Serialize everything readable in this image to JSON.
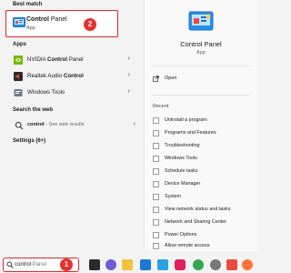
{
  "left": {
    "best_match_title": "Best match",
    "best_match": {
      "name_bold": "Control",
      "name_rest": " Panel",
      "sub": "App"
    },
    "apps_title": "Apps",
    "apps": [
      {
        "pre": "NVIDIA ",
        "bold": "Control",
        "post": " Panel",
        "icon": "nvidia-icon"
      },
      {
        "pre": "Realtek Audio ",
        "bold": "Control",
        "post": "",
        "icon": "realtek-audio-icon"
      },
      {
        "pre": "Windows Tools",
        "bold": "",
        "post": "",
        "icon": "windows-tools-icon"
      }
    ],
    "web_title": "Search the web",
    "web": {
      "query": "control",
      "suffix": " - See web results"
    },
    "settings": "Settings (6+)"
  },
  "search": {
    "typed": "control",
    "placeholder_rest": " Panel"
  },
  "badges": {
    "search": "1",
    "best_match": "2"
  },
  "right": {
    "title": "Control Panel",
    "subtitle": "App",
    "open": "Open",
    "recent_title": "Recent",
    "recent": [
      "Uninstall a program",
      "Programs and Features",
      "Troubleshooting",
      "Windows Tools",
      "Schedule tasks",
      "Device Manager",
      "System",
      "View network status and tasks",
      "Network and Sharing Center",
      "Power Options",
      "Allow remote access"
    ]
  },
  "taskbar": [
    "task-view-icon",
    "chat-icon",
    "file-explorer-icon",
    "mail-icon",
    "store-icon",
    "slack-icon",
    "chrome-icon",
    "settings-icon",
    "app-icon",
    "firefox-icon",
    "chrome-canary-icon"
  ],
  "colors": {
    "highlight_red": "#e0262b",
    "badge_red": "#e8302f",
    "accent_blue": "#1a6fd0"
  }
}
